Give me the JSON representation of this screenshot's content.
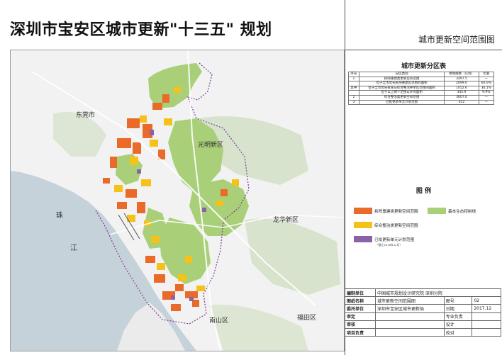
{
  "title": "深圳市宝安区城市更新\"十三五\" 规划",
  "map_name": "城市更新空间范围图",
  "map": {
    "place_labels": [
      "东莞市",
      "光明新区",
      "龙华新区",
      "南山区",
      "福田区",
      "珠",
      "江"
    ]
  },
  "zone_table": {
    "title": "城市更新分区表",
    "headers": [
      "序号",
      "分区类别",
      "用地规模（公顷）",
      "比重"
    ],
    "rows": [
      [
        "1",
        "拆除重建类更新空间范围",
        "3497.5",
        "—"
      ],
      [
        "",
        "位于全市优先拆除重建区范围的面积",
        "2099.0",
        "60.0%"
      ],
      [
        "其中",
        "位于全市优先拆除与综合整治并举区范围的面积",
        "1052.6",
        "30.1%"
      ],
      [
        "",
        "位于以上两个范围以外的面积",
        "345.9",
        "9.9%"
      ],
      [
        "2",
        "综合整治类更新空间范围",
        "3607.0",
        "—"
      ],
      [
        "3",
        "已批更新单元计划范围",
        "612",
        "—"
      ]
    ]
  },
  "legend": {
    "title": "图 例",
    "items": [
      {
        "label": "拆除重建类更新空间范围",
        "color": "#ea6a2a"
      },
      {
        "label": "基本生态控制线",
        "color": "#a9cf79"
      },
      {
        "label": "综合整治类更新空间范围",
        "color": "#f5c21a"
      },
      {
        "label": "已批更新单元计划范围",
        "color": "#8a62aa"
      }
    ],
    "note": "（截止2016年12月）"
  },
  "info": {
    "rows": [
      [
        "编制单位",
        "中国城市规划设计研究院  深圳分院",
        "",
        ""
      ],
      [
        "图纸名称",
        "城市更新空间范围图",
        "图号",
        "02"
      ],
      [
        "委托单位",
        "深圳市宝安区城市更新局",
        "日期",
        "2017.12"
      ],
      [
        "审定",
        "",
        "专业负责",
        ""
      ],
      [
        "审核",
        "",
        "设计",
        ""
      ],
      [
        "项目负责",
        "",
        "校对",
        ""
      ]
    ]
  },
  "colors": {
    "sea": "#c6d2da",
    "land": "#f2f2f2",
    "ecology": "#a9cf79",
    "demolition": "#ea6a2a",
    "renovation": "#f5c21a",
    "approved": "#8a62aa"
  }
}
